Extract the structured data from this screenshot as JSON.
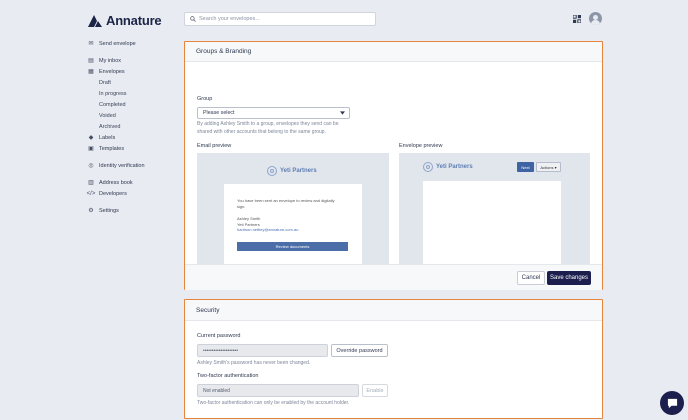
{
  "app": {
    "name": "Annature"
  },
  "search": {
    "placeholder": "Search your envelopes..."
  },
  "sidebar": {
    "items": [
      {
        "label": "Send envelope",
        "icon": "send-icon"
      },
      {
        "label": "My inbox",
        "icon": "inbox-icon"
      },
      {
        "label": "Envelopes",
        "icon": "envelopes-icon"
      },
      {
        "label": "Draft"
      },
      {
        "label": "In progress"
      },
      {
        "label": "Completed"
      },
      {
        "label": "Voided"
      },
      {
        "label": "Archived"
      },
      {
        "label": "Labels",
        "icon": "tag-icon"
      },
      {
        "label": "Templates",
        "icon": "template-icon"
      },
      {
        "label": "Identity verification",
        "icon": "fingerprint-icon"
      },
      {
        "label": "Address book",
        "icon": "address-book-icon"
      },
      {
        "label": "Developers",
        "icon": "code-icon"
      },
      {
        "label": "Settings",
        "icon": "settings-icon"
      }
    ]
  },
  "branding": {
    "title": "Groups & Branding",
    "group_label": "Group",
    "group_select": "Please select",
    "help_line1": "By adding Ashley Smith to a group, envelopes they send can be",
    "help_line2": "shared with other accounts that belong to the same group.",
    "email_preview_label": "Email preview",
    "envelope_preview_label": "Envelope preview",
    "brand_name": "Yeti Partners",
    "email_line1": "You have been sent an envelope to review and digitally",
    "email_line2": "sign.",
    "email_name": "Ashley Smith",
    "email_company": "Yeti Partners",
    "email_address": "harrison.nettley@annature.com.au",
    "email_button": "Review documents",
    "env_next": "Next",
    "env_actions": "Actions ▾",
    "cancel": "Cancel",
    "save": "Save changes"
  },
  "security": {
    "title": "Security",
    "current_password_label": "Current password",
    "password_value": "••••••••••••••••••••",
    "override_button": "Override password",
    "password_help": "Ashley Smith's password has never been changed.",
    "twofa_label": "Two-factor authentication",
    "twofa_value": "Not enabled",
    "enable_button": "Enable",
    "twofa_help": "Two-factor authentication can only be enabled by the account holder."
  },
  "colors": {
    "accent": "#1c1f4d",
    "panel_border": "#e7853d",
    "background": "#e8ebf1"
  }
}
